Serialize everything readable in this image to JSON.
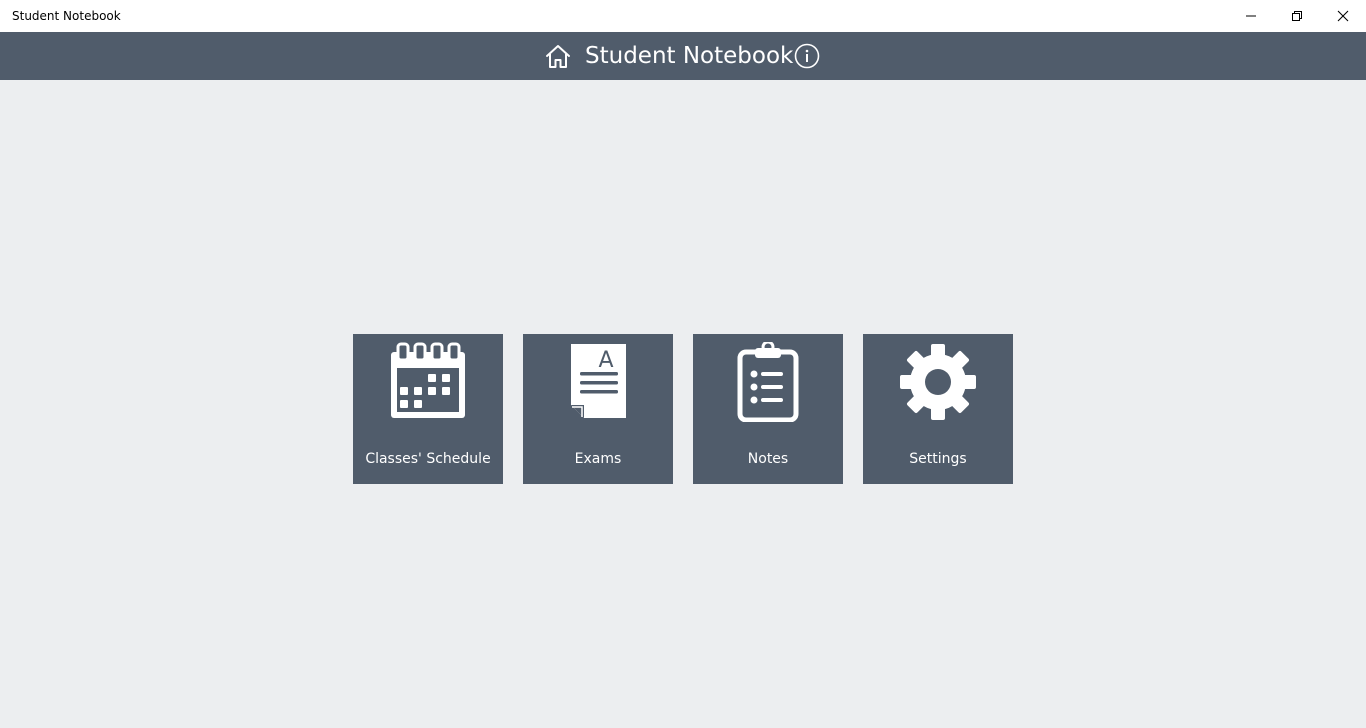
{
  "window": {
    "title": "Student Notebook"
  },
  "header": {
    "title": "Student Notebook",
    "home_icon": "home-icon",
    "info_icon": "info-icon"
  },
  "tiles": [
    {
      "label": "Classes' Schedule",
      "icon": "calendar-icon"
    },
    {
      "label": "Exams",
      "icon": "exam-document-icon"
    },
    {
      "label": "Notes",
      "icon": "clipboard-list-icon"
    },
    {
      "label": "Settings",
      "icon": "gear-icon"
    }
  ],
  "colors": {
    "header_bg": "#505c6b",
    "tile_bg": "#505c6b",
    "page_bg": "#eceef0",
    "foreground": "#ffffff"
  }
}
